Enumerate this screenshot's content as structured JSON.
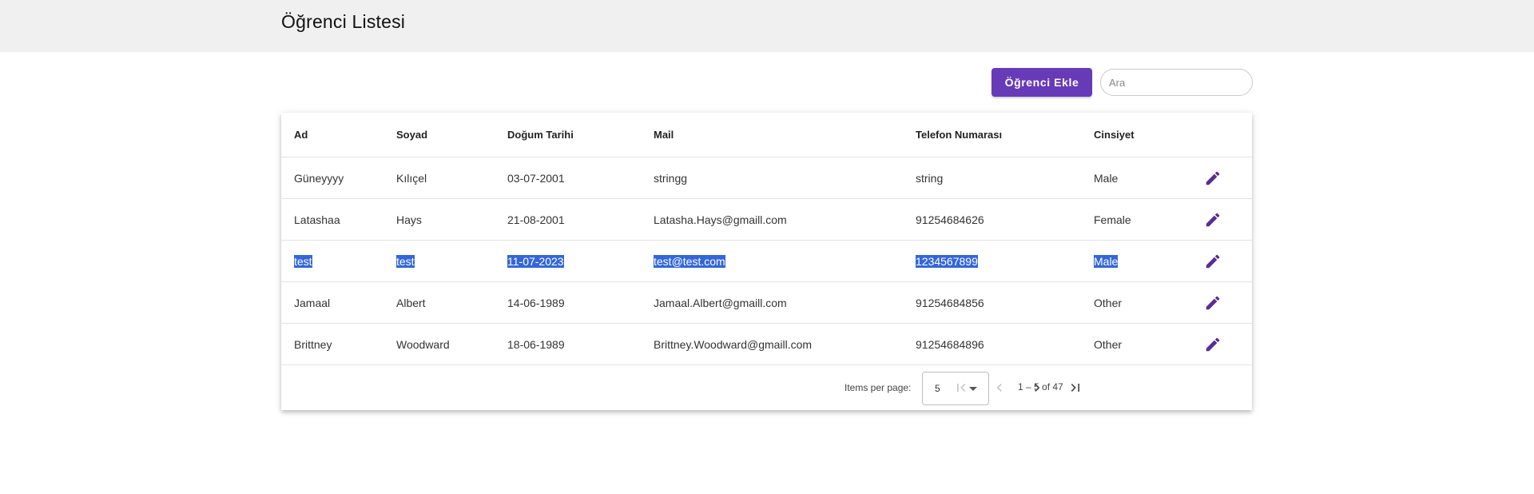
{
  "header": {
    "title": "Öğrenci Listesi"
  },
  "toolbar": {
    "add_label": "Öğrenci Ekle",
    "search_placeholder": "Ara",
    "search_value": ""
  },
  "table": {
    "columns": [
      "Ad",
      "Soyad",
      "Doğum Tarihi",
      "Mail",
      "Telefon Numarası",
      "Cinsiyet"
    ],
    "rows": [
      [
        "Güneyyyy",
        "Kılıçel",
        "03-07-2001",
        "stringg",
        "string",
        "Male"
      ],
      [
        "Latashaa",
        "Hays",
        "21-08-2001",
        "Latasha.Hays@gmaill.com",
        "91254684626",
        "Female"
      ],
      [
        "test",
        "test",
        "11-07-2023",
        "test@test.com",
        "1234567899",
        "Male"
      ],
      [
        "Jamaal",
        "Albert",
        "14-06-1989",
        "Jamaal.Albert@gmaill.com",
        "91254684856",
        "Other"
      ],
      [
        "Brittney",
        "Woodward",
        "18-06-1989",
        "Brittney.Woodward@gmaill.com",
        "91254684896",
        "Other"
      ]
    ],
    "row_icon": "edit-pencil-icon"
  },
  "paginator": {
    "items_per_page_label": "Items per page:",
    "page_size": "5",
    "range_label": "1 – 5 of 47"
  },
  "colors": {
    "accent": "#673ab7",
    "edit_icon": "#5a2d91",
    "selection": "#3367d6",
    "header_bg": "#f0f0f0"
  }
}
